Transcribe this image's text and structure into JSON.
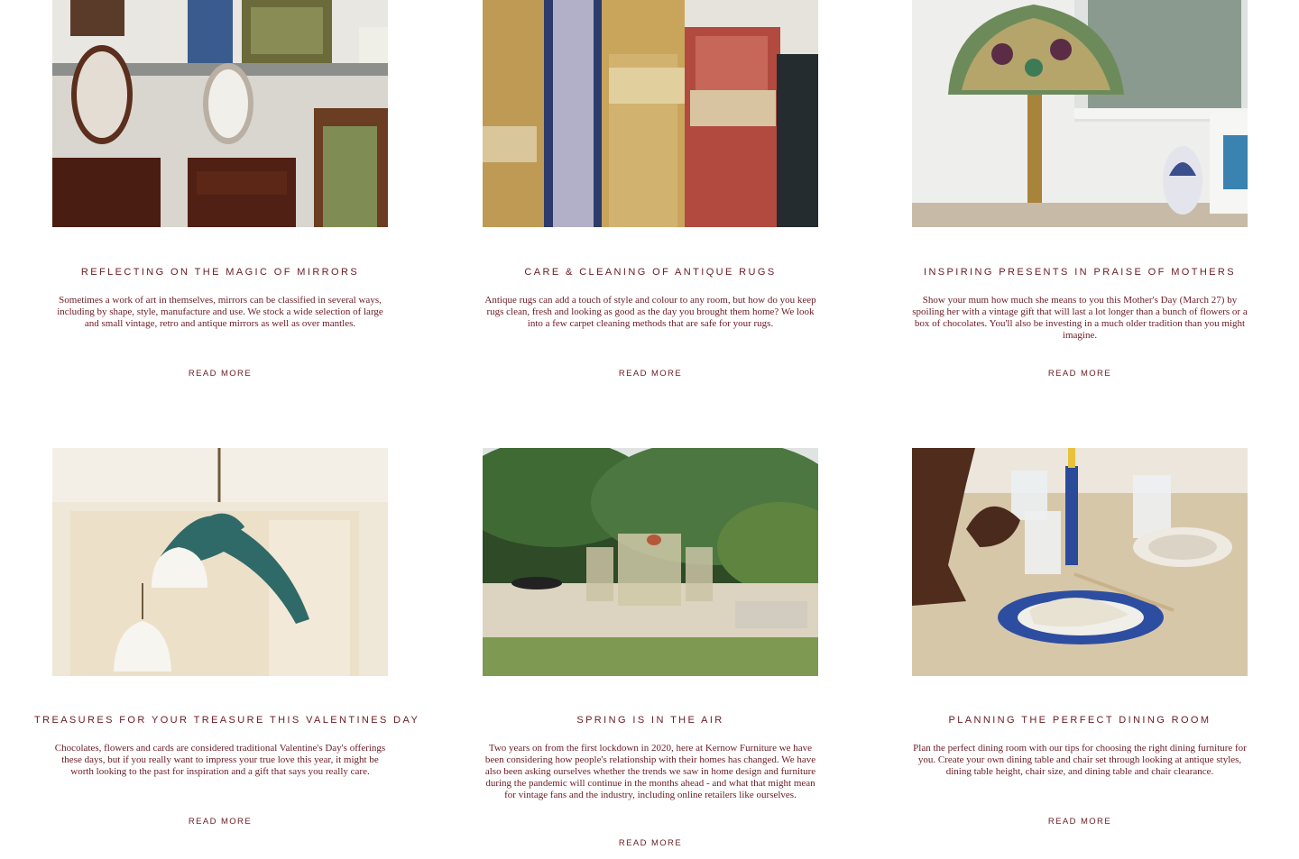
{
  "colors": {
    "accent": "#6b1a22",
    "background": "#ffffff"
  },
  "posts": [
    {
      "image": "mirrors-dressing-table-photo",
      "title": "Reflecting on the magic of mirrors",
      "excerpt": "Sometimes a work of art in themselves, mirrors can be classified in several ways, including by shape, style, manufacture and use. We stock a wide selection of large and small vintage, retro and antique mirrors as well as over mantles.",
      "link": "Read More"
    },
    {
      "image": "rolled-antique-rugs-photo",
      "title": "Care & cleaning of antique rugs",
      "excerpt": "Antique rugs can add a touch of style and colour to any room, but how do you keep rugs clean, fresh and looking as good as the day you brought them home? We look into a few carpet cleaning methods that are safe for your rugs.",
      "link": "Read More"
    },
    {
      "image": "stained-glass-lamp-photo",
      "title": "Inspiring presents in praise of mothers",
      "excerpt": "Show your mum how much she means to you this Mother's Day (March 27) by spoiling her with a vintage gift that will last a lot longer than a bunch of flowers or a box of chocolates. You'll also be investing in a much older tradition than you might imagine.",
      "link": "Read More"
    },
    {
      "image": "cherub-pendant-light-photo",
      "title": "Treasures for your treasure this Valentines Day",
      "excerpt": "Chocolates, flowers and cards are considered traditional Valentine's Day's offerings these days, but if you really want to impress your true love this year, it might be worth looking to the past for inspiration and a gift that says you really care.",
      "link": "Read More"
    },
    {
      "image": "garden-patio-furniture-photo",
      "title": "Spring is in the air",
      "excerpt": "Two years on from the first lockdown in 2020, here at Kernow Furniture we have been considering how people's relationship with their homes has changed. We have also been asking ourselves whether the trends we saw in home design and furniture during the pandemic will continue in the months ahead - and what that might mean for vintage fans and the industry, including online retailers like ourselves.",
      "link": "Read More"
    },
    {
      "image": "dining-table-setting-photo",
      "title": "Planning the perfect dining room",
      "excerpt": "Plan the perfect dining room with our tips for choosing the right dining furniture for you. Create your own dining table and chair set through looking at antique styles, dining table height, chair size, and dining table and chair clearance.",
      "link": "Read More"
    }
  ]
}
